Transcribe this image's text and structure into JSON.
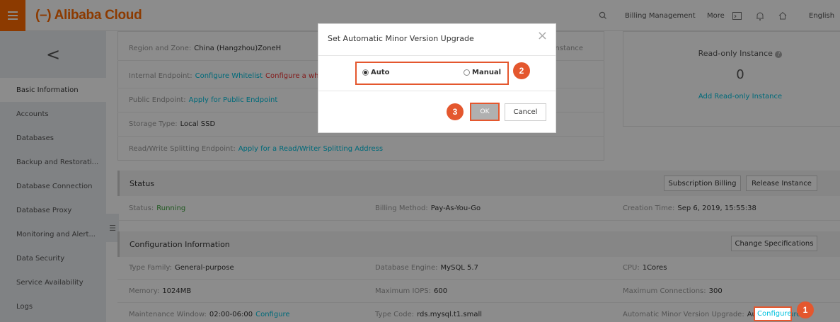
{
  "header": {
    "logo": "(–) Alibaba Cloud",
    "nav": [
      "Billing Management",
      "More"
    ],
    "language": "English"
  },
  "sidebar": {
    "back": "<",
    "items": [
      {
        "label": "Basic Information",
        "active": true
      },
      {
        "label": "Accounts"
      },
      {
        "label": "Databases"
      },
      {
        "label": "Backup and Restorati..."
      },
      {
        "label": "Database Connection"
      },
      {
        "label": "Database Proxy"
      },
      {
        "label": "Monitoring and Alert..."
      },
      {
        "label": "Data Security"
      },
      {
        "label": "Service Availability"
      },
      {
        "label": "Logs"
      }
    ]
  },
  "basic": {
    "region_label": "Region and Zone:",
    "region_value": "China (Hangzhou)ZoneH",
    "instance_partial": "nstance",
    "internal_label": "Internal Endpoint:",
    "internal_link1": "Configure Whitelist",
    "internal_link2": "Configure a whitelis",
    "public_label": "Public Endpoint:",
    "public_link": "Apply for Public Endpoint",
    "storage_label": "Storage Type:",
    "storage_value": "Local SSD",
    "rw_label": "Read/Write Splitting Endpoint:",
    "rw_link": "Apply for a Read/Writer Splitting Address"
  },
  "readonly": {
    "title": "Read-only Instance",
    "count": "0",
    "add_link": "Add Read-only Instance"
  },
  "status": {
    "title": "Status",
    "btn_subscription": "Subscription Billing",
    "btn_release": "Release Instance",
    "status_label": "Status:",
    "status_value": "Running",
    "billing_label": "Billing Method:",
    "billing_value": "Pay-As-You-Go",
    "created_label": "Creation Time:",
    "created_value": "Sep 6, 2019, 15:55:38"
  },
  "config": {
    "title": "Configuration Information",
    "btn_change": "Change Specifications",
    "type_family_label": "Type Family:",
    "type_family_value": "General-purpose",
    "engine_label": "Database Engine:",
    "engine_value": "MySQL 5.7",
    "cpu_label": "CPU:",
    "cpu_value": "1Cores",
    "memory_label": "Memory:",
    "memory_value": "1024MB",
    "iops_label": "Maximum IOPS:",
    "iops_value": "600",
    "conn_label": "Maximum Connections:",
    "conn_value": "300",
    "maint_label": "Maintenance Window:",
    "maint_value": "02:00-06:00",
    "maint_link": "Configure",
    "typecode_label": "Type Code:",
    "typecode_value": "rds.mysql.t1.small",
    "upgrade_label": "Automatic Minor Version Upgrade:",
    "upgrade_value": "Auto",
    "upgrade_link": "Configure"
  },
  "dialog": {
    "title": "Set Automatic Minor Version Upgrade",
    "close": "×",
    "option_auto": "Auto",
    "option_manual": "Manual",
    "selected": "Auto",
    "ok": "OK",
    "cancel": "Cancel"
  },
  "callouts": [
    "1",
    "2",
    "3"
  ],
  "colors": {
    "brand": "#ff6a00",
    "link": "#00c1de",
    "callout": "#e4572e",
    "running": "#3da33d"
  }
}
